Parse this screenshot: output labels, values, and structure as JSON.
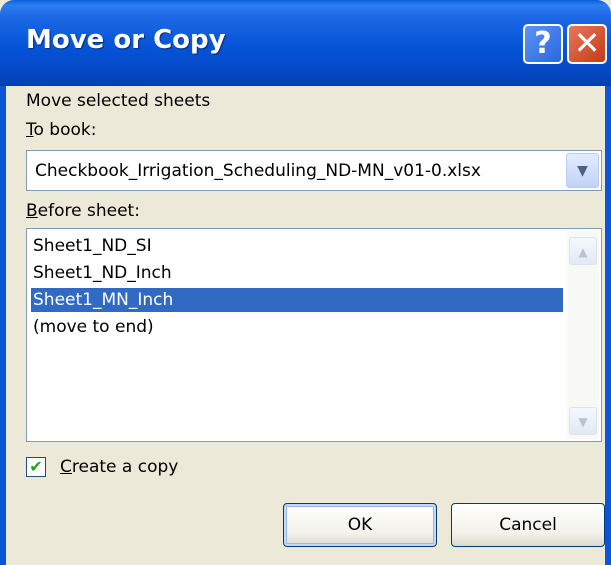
{
  "window": {
    "title": "Move or Copy"
  },
  "titlebar": {
    "help_label": "?",
    "close_label": "✕"
  },
  "dialog": {
    "intro": "Move selected sheets",
    "to_book_label_accel": "T",
    "to_book_label_rest": "o book:",
    "to_book_value": "Checkbook_Irrigation_Scheduling_ND-MN_v01-0.xlsx",
    "before_sheet_label_accel": "B",
    "before_sheet_label_rest": "efore sheet:",
    "sheets": [
      "Sheet1_ND_SI",
      "Sheet1_ND_Inch",
      "Sheet1_MN_Inch",
      "(move to end)"
    ],
    "selected_sheet": "Sheet1_MN_Inch",
    "create_copy_accel": "C",
    "create_copy_rest": "reate a copy",
    "create_copy_checked": true
  },
  "buttons": {
    "ok": "OK",
    "cancel": "Cancel"
  },
  "icons": {
    "help": "question-icon",
    "close": "close-icon",
    "dropdown": "chevron-down-icon",
    "scroll_up": "scroll-up-arrow-icon",
    "scroll_down": "scroll-down-arrow-icon",
    "check": "checkmark-icon"
  },
  "colors": {
    "title_bar": "#0554d8",
    "selection": "#316ac5",
    "dialog_bg": "#ece9d8"
  }
}
